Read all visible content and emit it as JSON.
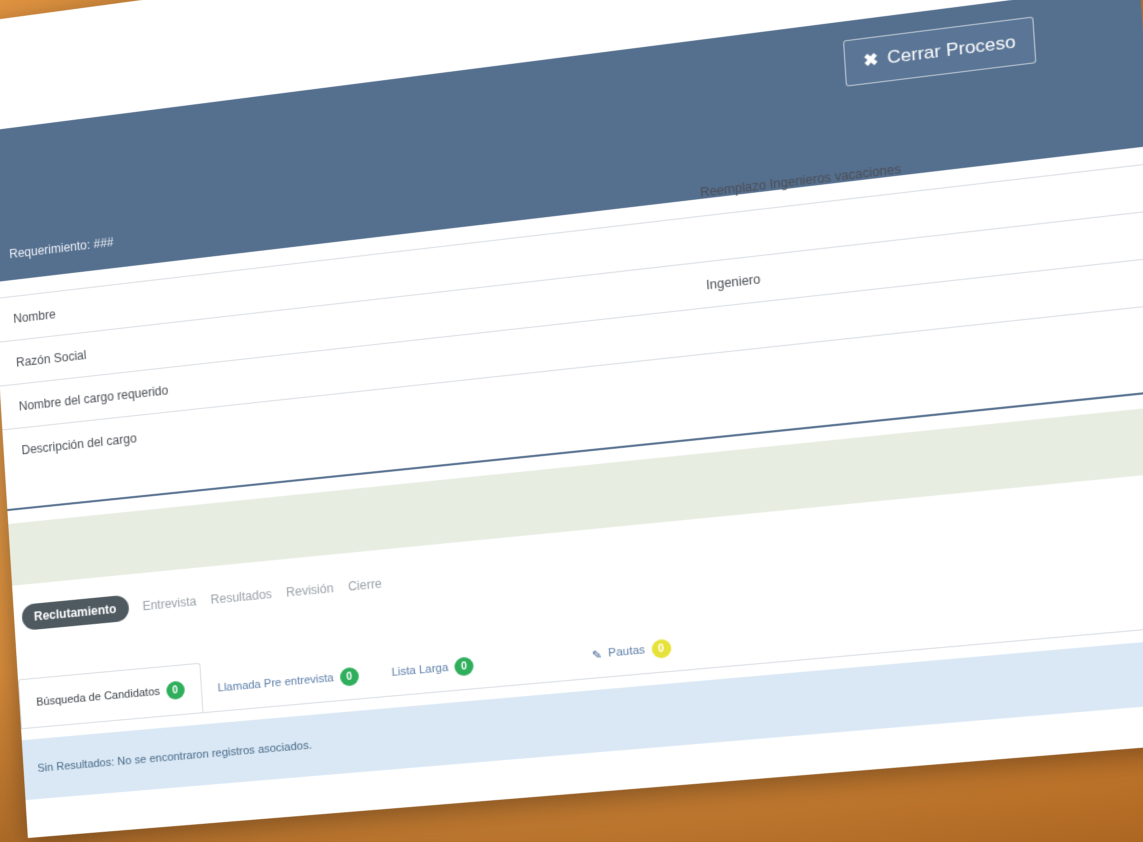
{
  "header": {
    "close_button_label": "Cerrar Proceso",
    "close_icon": "close-icon"
  },
  "panel": {
    "title": "Requerimiento: ###",
    "rows": [
      {
        "label": "",
        "value": "Reemplazo Ingenieros vacaciones"
      },
      {
        "label": "Nombre",
        "value": ""
      },
      {
        "label": "Razón Social",
        "value": "Ingeniero"
      },
      {
        "label": "Nombre del cargo requerido",
        "value": ""
      },
      {
        "label": "Descripción del cargo",
        "value": ""
      }
    ]
  },
  "stepper": {
    "active": "Reclutamiento",
    "steps": [
      "Entrevista",
      "Resultados",
      "Revisión",
      "Cierre"
    ]
  },
  "tabs": [
    {
      "label": "Búsqueda de Candidatos",
      "count": "0",
      "badge_color": "#2fae5c",
      "active": true
    },
    {
      "label": "Llamada Pre entrevista",
      "count": "0",
      "badge_color": "#2fae5c",
      "active": false
    },
    {
      "label": "Lista Larga",
      "count": "0",
      "badge_color": "#2fae5c",
      "active": false
    },
    {
      "label": "Pautas",
      "count": "0",
      "badge_color": "#e6e23a",
      "active": false,
      "icon": "pencil-icon"
    }
  ],
  "alert": {
    "text": "Sin Resultados: No se encontraron registros asociados."
  },
  "colors": {
    "header_blue": "#556f8e",
    "background_orange": "#e79a45",
    "strip_green": "#e7ede1",
    "alert_blue": "#d9e8f4"
  }
}
